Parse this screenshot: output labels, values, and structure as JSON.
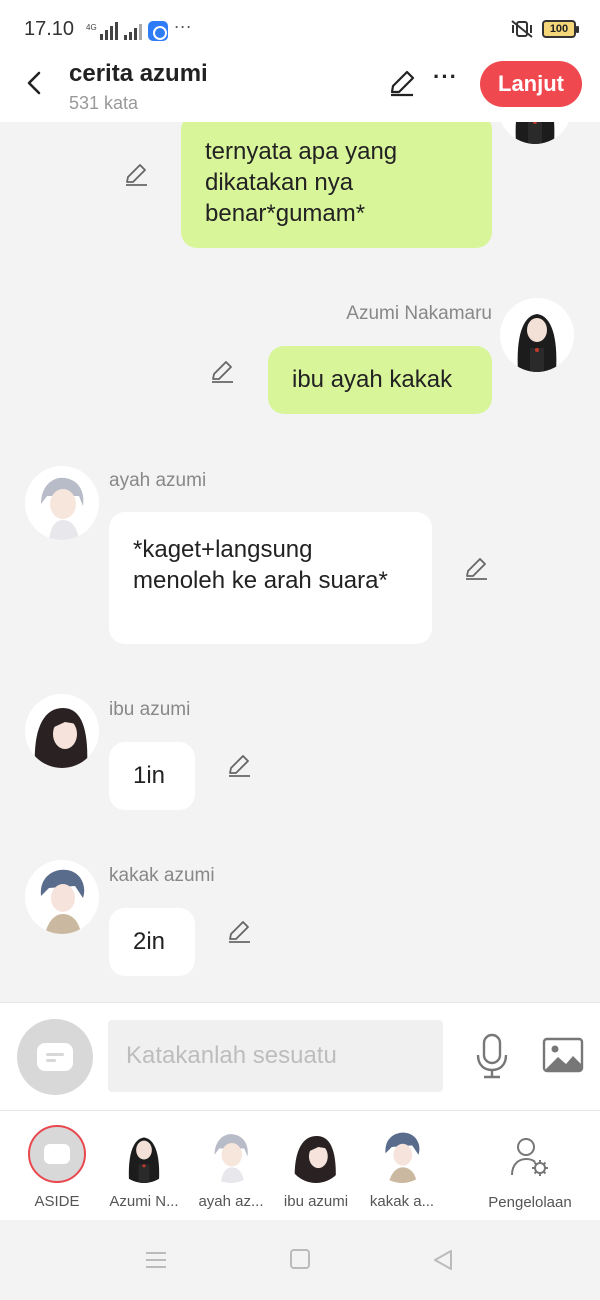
{
  "status_bar": {
    "time": "17.10",
    "battery": "100"
  },
  "header": {
    "title": "cerita azumi",
    "subtitle": "531 kata",
    "next_label": "Lanjut"
  },
  "messages": [
    {
      "side": "right",
      "sender": "",
      "text": "ternyata apa yang dikatakan nya benar*gumam*"
    },
    {
      "side": "right",
      "sender": "Azumi Nakamaru",
      "text": "ibu ayah kakak"
    },
    {
      "side": "left",
      "sender": "ayah azumi",
      "text": "*kaget+langsung menoleh ke arah suara*"
    },
    {
      "side": "left",
      "sender": "ibu azumi",
      "text": "1in"
    },
    {
      "side": "left",
      "sender": "kakak azumi",
      "text": "2in"
    }
  ],
  "composer": {
    "placeholder": "Katakanlah sesuatu"
  },
  "characters": [
    {
      "label": "ASIDE"
    },
    {
      "label": "Azumi N..."
    },
    {
      "label": "ayah az..."
    },
    {
      "label": "ibu azumi"
    },
    {
      "label": "kakak a..."
    }
  ],
  "manage": {
    "label": "Pengelolaan"
  },
  "colors": {
    "accent": "#f0484f",
    "my_bubble": "#d9f59a",
    "other_bubble": "#ffffff",
    "background": "#f3f3f3"
  },
  "icons": [
    "back-arrow-icon",
    "pencil-icon",
    "more-icon",
    "mic-icon",
    "image-icon",
    "manage-user-icon",
    "menu-icon",
    "home-icon",
    "nav-back-icon"
  ]
}
